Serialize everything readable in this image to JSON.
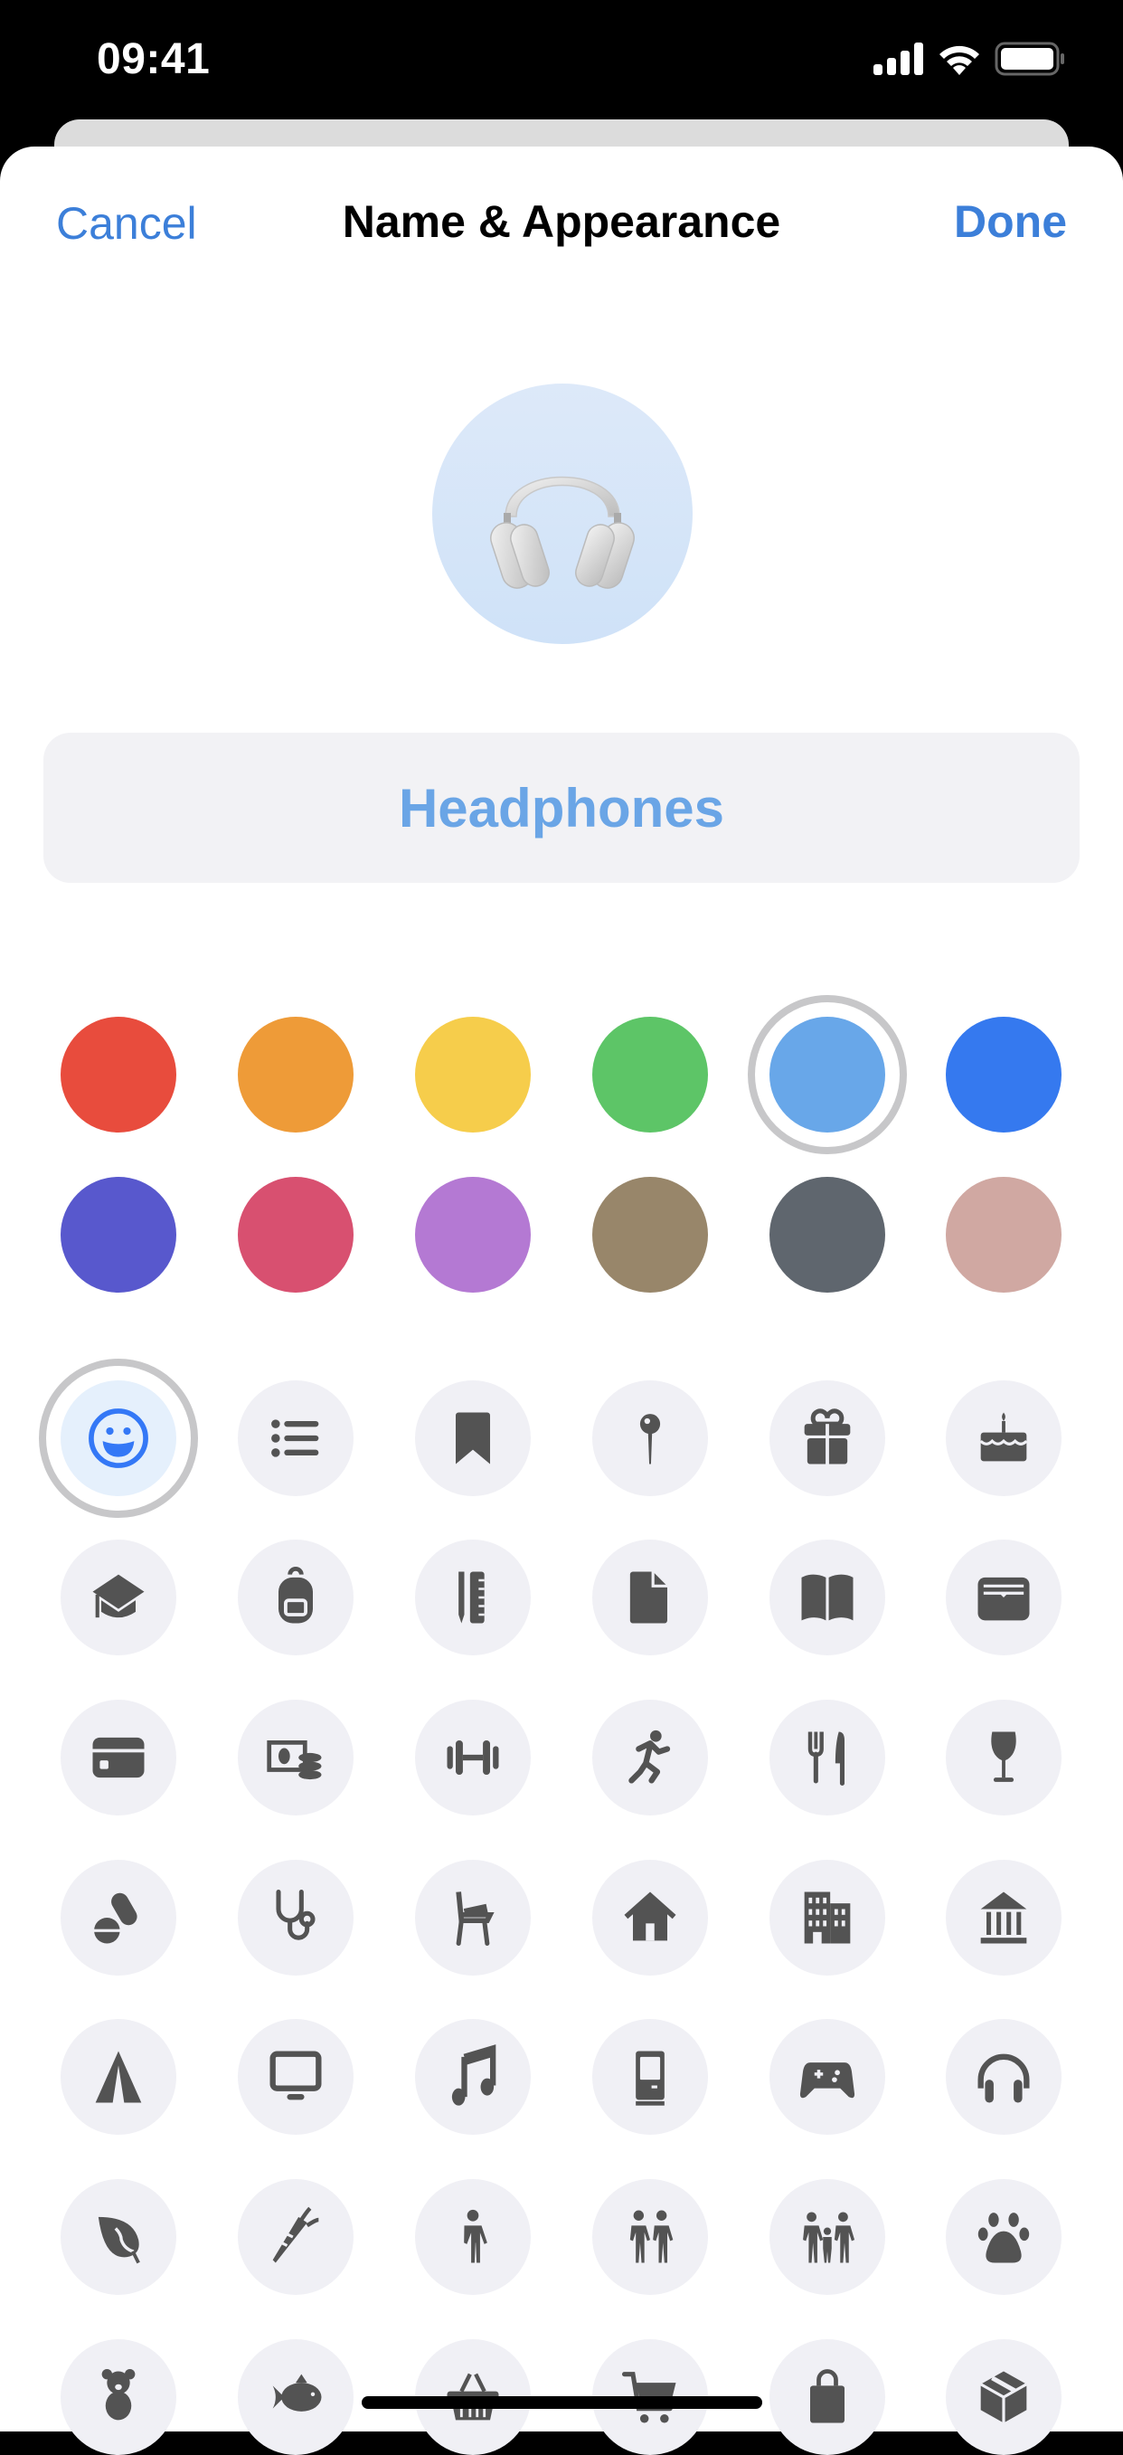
{
  "status_bar": {
    "time": "09:41"
  },
  "nav": {
    "cancel_label": "Cancel",
    "title": "Name & Appearance",
    "done_label": "Done"
  },
  "avatar": {
    "icon": "headphones-emoji"
  },
  "name_field": {
    "value": "Headphones",
    "text_color": "#6aa5e6"
  },
  "colors": {
    "selected_index": 4,
    "swatches": [
      {
        "name": "red",
        "hex": "#e84c3d"
      },
      {
        "name": "orange",
        "hex": "#ee9b38"
      },
      {
        "name": "yellow",
        "hex": "#f6cd4b"
      },
      {
        "name": "green",
        "hex": "#5dc567"
      },
      {
        "name": "light-blue",
        "hex": "#68a7e9"
      },
      {
        "name": "blue",
        "hex": "#3579ef"
      },
      {
        "name": "indigo",
        "hex": "#5858cd"
      },
      {
        "name": "pink",
        "hex": "#d85070"
      },
      {
        "name": "purple",
        "hex": "#b479d3"
      },
      {
        "name": "brown",
        "hex": "#98866a"
      },
      {
        "name": "dark-gray",
        "hex": "#5f666e"
      },
      {
        "name": "rose-gold",
        "hex": "#d0a8a2"
      }
    ]
  },
  "icons": {
    "selected_index": 0,
    "items": [
      "smiley",
      "list-bullet",
      "bookmark",
      "pin",
      "gift",
      "birthday-cake",
      "graduation-cap",
      "backpack",
      "pencil-ruler",
      "document",
      "book",
      "archive-tray",
      "credit-card",
      "money-coins",
      "dumbbell",
      "running-figure",
      "fork-knife",
      "wine-glass",
      "pills",
      "stethoscope",
      "chair",
      "house",
      "office-building",
      "bank-columns",
      "tent",
      "desktop-display",
      "music-note",
      "computer-tower",
      "game-controller",
      "headphones",
      "leaf",
      "carrot",
      "person",
      "two-people",
      "family",
      "paw-print",
      "teddy-bear",
      "fish",
      "shopping-basket",
      "shopping-cart",
      "shopping-bag",
      "package-box"
    ]
  },
  "theme": {
    "accent": "#3c7fd9",
    "icon_bg": "#f0f0f5",
    "icon_fg": "#535353",
    "selected_icon_color": "#3478f6"
  }
}
